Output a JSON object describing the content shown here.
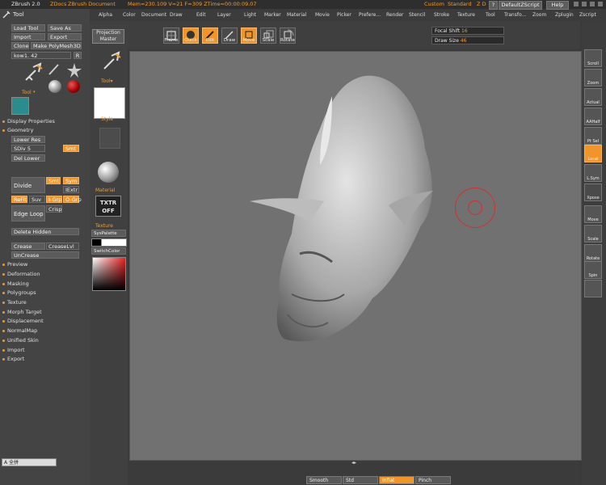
{
  "titlebar": {
    "app": "ZBrush 2.0",
    "docs": "ZDocs",
    "doc": "ZBrush Document",
    "mem": "Mem=230.109 V=21 F=309 ZTime=00:00:09.07",
    "custom": "Custom",
    "standard": "Standard",
    "zd": "Z D",
    "question": "?",
    "default_zscript": "DefaultZScript",
    "help": "Help"
  },
  "menu": [
    "Alpha",
    "Color",
    "Document",
    "Draw",
    "Edit",
    "Layer",
    "Light",
    "Marker",
    "Material",
    "Movie",
    "Picker",
    "Prefere...",
    "Render",
    "Stencil",
    "Stroke",
    "Texture",
    "Tool",
    "Transfo...",
    "Zoom",
    "Zplugin",
    "Zscript"
  ],
  "left": {
    "title": "Tool",
    "load_tool": "Load Tool",
    "save_as": "Save As",
    "import": "Import",
    "export": "Export",
    "clone": "Clone",
    "make_polymesh": "Make PolyMesh3D",
    "tool_name": "kow1. 42",
    "tool_label": "Tool",
    "display_properties": "Display Properties",
    "geometry": "Geometry",
    "lower_res": "Lower Res",
    "sdiv_label": "SDiv 5",
    "smt": "Smt",
    "del_lower": "Del Lower",
    "divide": "Divide",
    "smt2": "Smt",
    "sym": "Sym",
    "iextr": "IExtr",
    "refit": "ReFit",
    "suv": "Suv",
    "igrp": "I-Grp",
    "ogrp": "O-Grp",
    "edge_loop": "Edge Loop",
    "crisp": "Crisp",
    "delete_hidden": "Delete Hidden",
    "crease": "Crease",
    "crease_lvl": "CreaseLvl",
    "uncrease": "UnCrease",
    "sections": [
      "Preview",
      "Deformation",
      "Masking",
      "Polygroups",
      "Texture",
      "Morph Target",
      "Displacement",
      "NormalMap",
      "Unified Skin",
      "Import",
      "Export"
    ],
    "ime": "A 全拼"
  },
  "col2": {
    "style": "Style",
    "material": "Material",
    "txtr": "TXTR",
    "off": "OFF",
    "texture": "Texture",
    "syspalette": "SysPalette",
    "switchcolor": "SwitchColor"
  },
  "toolbar": {
    "projection": "Projection",
    "master": "Master",
    "frame": "Frame",
    "quick": "Quick",
    "edit": "Edit",
    "draw": "Draw",
    "move": "Move",
    "scale": "Scale",
    "rotate": "Rotate",
    "focal_shift": "Focal Shift",
    "focal_value": "16",
    "draw_size": "Draw Size",
    "draw_value": "46"
  },
  "shelf": [
    "Scroll",
    "Zoom",
    "Actual",
    "AAHalf",
    "Pt Sel",
    "Local",
    "L.Sym",
    "Xpose",
    "Move",
    "Scale",
    "Rotate",
    "Spin",
    ""
  ],
  "bottom": [
    "Smooth",
    "Std",
    "Inflat",
    "Pinch"
  ],
  "colors": {
    "accent": "#f0952a",
    "canvas": "#717171",
    "panel": "#444444"
  }
}
